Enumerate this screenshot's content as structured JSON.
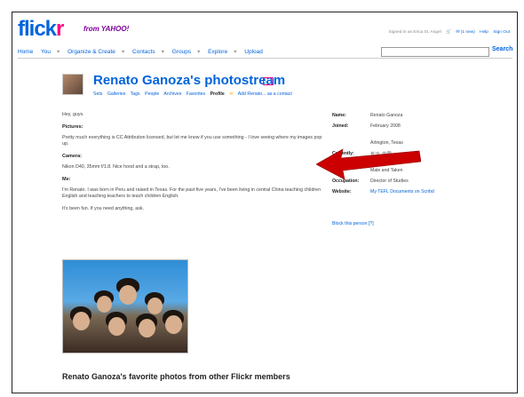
{
  "header": {
    "logo_main": "flick",
    "logo_r": "r",
    "logo_sub": "from YAHOO!",
    "nav": [
      "Home",
      "You",
      "Organize & Create",
      "Contacts",
      "Groups",
      "Explore",
      "Upload"
    ],
    "signed_in": "Signed in as Erica St. Angel",
    "mail": "(1 new)",
    "help": "Help",
    "sign_out": "Sign Out",
    "search_placeholder": "",
    "search_label": "Search"
  },
  "profile": {
    "title": "Renato Ganoza's photostream",
    "subnav": [
      "Sets",
      "Galleries",
      "Tags",
      "People",
      "Archives",
      "Favorites"
    ],
    "subnav_active": "Profile",
    "add_contact": "Add Renato... as a contact"
  },
  "about": {
    "greeting": "Hey, guys.",
    "pictures_heading": "Pictures:",
    "pictures_text": "Pretty much everything is CC Attribution licensed, but let me know if you use something - I love seeing where my images pop up.",
    "camera_heading": "Camera:",
    "camera_text": "Nikon D40, 35mm f/1.8. Nice hood and a strap, too.",
    "me_heading": "Me:",
    "me_text": "I'm Renato. I was born in Peru and raised in Texas. For the past five years, I've been living in central China teaching children English and teaching teachers to teach children English.",
    "closing": "It's been fun. If you need anything, ask."
  },
  "details": {
    "name_label": "Name:",
    "name_value": "Renato Ganoza",
    "joined_label": "Joined:",
    "joined_value": "February 2008",
    "hometown_value": "Arlington, Texas",
    "currently_label": "Currently:",
    "currently_value": "长沙, 中国",
    "iam_label": "I am:",
    "iam_value": "Male and Taken",
    "occupation_label": "Occupation:",
    "occupation_value": "Director of Studies",
    "website_label": "Website:",
    "website_value": "My TEFL Documents on Scribd",
    "block": "Block this person [?]"
  },
  "favorites_heading": "Renato Ganoza's favorite photos from other Flickr members",
  "colors": {
    "flickr_blue": "#0063dc",
    "flickr_pink": "#ff0084",
    "arrow_red": "#cc0000"
  }
}
